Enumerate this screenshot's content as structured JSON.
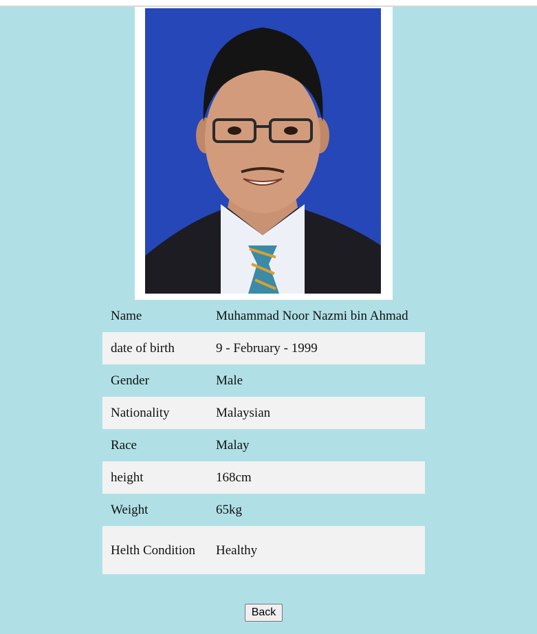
{
  "profile": {
    "photo_alt": "Portrait photo",
    "rows": [
      {
        "label": "Name",
        "value": "Muhammad Noor Nazmi bin Ahmad"
      },
      {
        "label": "date of birth",
        "value": "9 - February - 1999"
      },
      {
        "label": "Gender",
        "value": "Male"
      },
      {
        "label": "Nationality",
        "value": "Malaysian"
      },
      {
        "label": "Race",
        "value": "Malay"
      },
      {
        "label": "height",
        "value": "168cm"
      },
      {
        "label": "Weight",
        "value": "65kg"
      },
      {
        "label": "Helth Condition",
        "value": "Healthy"
      }
    ]
  },
  "actions": {
    "back_label": "Back"
  },
  "colors": {
    "page_background": "#b0e0e6",
    "stripe_row": "#f2f2f2",
    "photo_backdrop": "#2547b8"
  }
}
